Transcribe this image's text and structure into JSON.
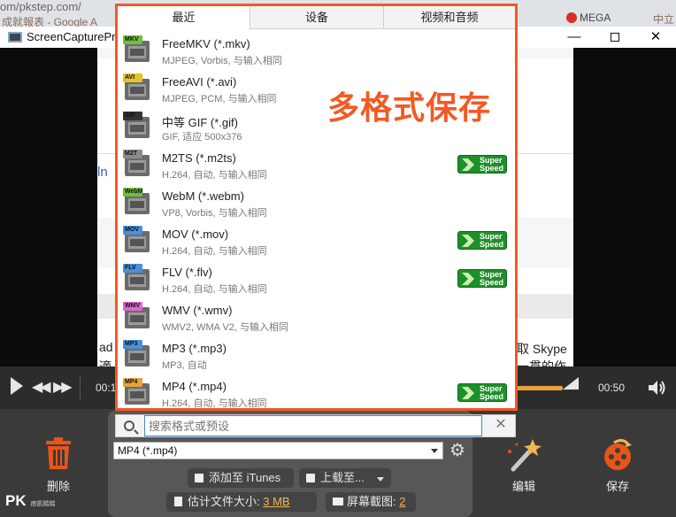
{
  "browser": {
    "url_fragment": "om/pkstep.com/",
    "bookmark_1": "成就報表 - Google A",
    "bookmark_2": "",
    "bookmark_3": "MEGA",
    "bookmark_4": "中立"
  },
  "window": {
    "title": "ScreenCapturePro",
    "min_label": "—",
    "close_label": "✕"
  },
  "preview": {
    "link_fragment": "ln",
    "right_text_1": "取 Skype",
    "right_text_2": "一貫的作",
    "left_text_1": "ad",
    "left_text_2": "適"
  },
  "player": {
    "time_current": "00:1",
    "time_total": "00:50"
  },
  "popup": {
    "tabs": [
      {
        "label": "最近",
        "active": true
      },
      {
        "label": "设备",
        "active": false
      },
      {
        "label": "视频和音频",
        "active": false
      }
    ],
    "formats": [
      {
        "name": "FreeMKV (*.mkv)",
        "desc": "MJPEG, Vorbis, 与输入相同",
        "icon_label": "MKV",
        "icon_color": "#6fbf3a",
        "super_speed": false
      },
      {
        "name": "FreeAVI (*.avi)",
        "desc": "MJPEG, PCM, 与输入相同",
        "icon_label": "AVI",
        "icon_color": "#e6c12a",
        "super_speed": false
      },
      {
        "name": "中等 GIF (*.gif)",
        "desc": "GIF, 适应 500x376",
        "icon_label": "GIF",
        "icon_color": "#333333",
        "super_speed": false
      },
      {
        "name": "M2TS (*.m2ts)",
        "desc": "H.264, 自动, 与输入相同",
        "icon_label": "M2T",
        "icon_color": "#8a8a8a",
        "super_speed": true
      },
      {
        "name": "WebM (*.webm)",
        "desc": "VP8, Vorbis, 与输入相同",
        "icon_label": "WebM",
        "icon_color": "#6fbf3a",
        "super_speed": false
      },
      {
        "name": "MOV (*.mov)",
        "desc": "H.264, 自动, 与输入相同",
        "icon_label": "MOV",
        "icon_color": "#4a90d9",
        "super_speed": true
      },
      {
        "name": "FLV (*.flv)",
        "desc": "H.264, 自动, 与输入相同",
        "icon_label": "FLV",
        "icon_color": "#4a90d9",
        "super_speed": true
      },
      {
        "name": "WMV (*.wmv)",
        "desc": "WMV2, WMA V2, 与输入相同",
        "icon_label": "WMV",
        "icon_color": "#d96ac9",
        "super_speed": false
      },
      {
        "name": "MP3 (*.mp3)",
        "desc": "MP3, 自动",
        "icon_label": "MP3",
        "icon_color": "#4a90d9",
        "super_speed": false
      },
      {
        "name": "MP4 (*.mp4)",
        "desc": "H.264, 自动, 与输入相同",
        "icon_label": "MP4",
        "icon_color": "#e8a23c",
        "super_speed": true
      }
    ],
    "badge_text_1": "Super",
    "badge_text_2": "Speed",
    "headline": "多格式保存"
  },
  "search": {
    "placeholder": "搜索格式或预设"
  },
  "output": {
    "selected_format": "MP4 (*.mp4)",
    "itunes_label": "添加至 iTunes",
    "upload_label": "上载至...",
    "size_label": "估计文件大小:",
    "size_value": "3 MB",
    "screenshot_label": "屏幕截图:",
    "screenshot_value": "2"
  },
  "actions": {
    "delete_label": "删除",
    "edit_label": "编辑",
    "save_label": "保存"
  },
  "watermark": {
    "logo": "PK",
    "sub": "痞凱踏踏"
  },
  "colors": {
    "accent": "#f15a24",
    "super_speed": "#1f8f2a",
    "progress": "#e8a23c",
    "delete_icon": "#e8541a"
  }
}
